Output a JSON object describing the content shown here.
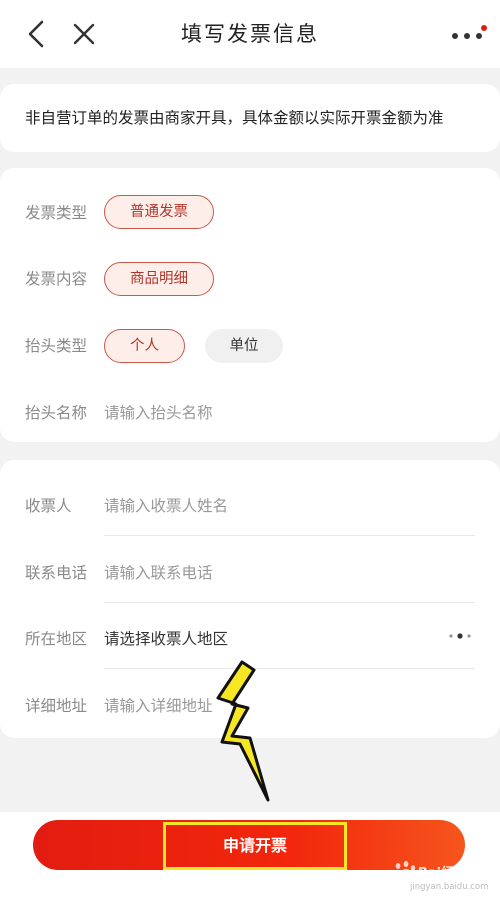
{
  "header": {
    "title": "填写发票信息"
  },
  "notice": {
    "text": "非自营订单的发票由商家开具，具体金额以实际开票金额为准"
  },
  "invoice_info": {
    "type": {
      "label": "发票类型",
      "options": [
        "普通发票"
      ],
      "selected": "普通发票"
    },
    "content": {
      "label": "发票内容",
      "options": [
        "商品明细"
      ],
      "selected": "商品明细"
    },
    "title_type": {
      "label": "抬头类型",
      "options": [
        "个人",
        "单位"
      ],
      "selected": "个人"
    },
    "title_name": {
      "label": "抬头名称",
      "placeholder": "请输入抬头名称"
    }
  },
  "recipient_info": {
    "name": {
      "label": "收票人",
      "placeholder": "请输入收票人姓名"
    },
    "phone": {
      "label": "联系电话",
      "placeholder": "请输入联系电话"
    },
    "region": {
      "label": "所在地区",
      "placeholder": "请选择收票人地区"
    },
    "address": {
      "label": "详细地址",
      "placeholder": "请输入详细地址"
    }
  },
  "footer": {
    "apply_label": "申请开票"
  },
  "watermark": {
    "text": "Bai经验",
    "sub": "jingyan.baidu.com"
  },
  "colors": {
    "accent": "#e21c10",
    "chip_border": "#c9584a",
    "chip_bg": "#fdeeea",
    "highlight": "#f7e624"
  }
}
